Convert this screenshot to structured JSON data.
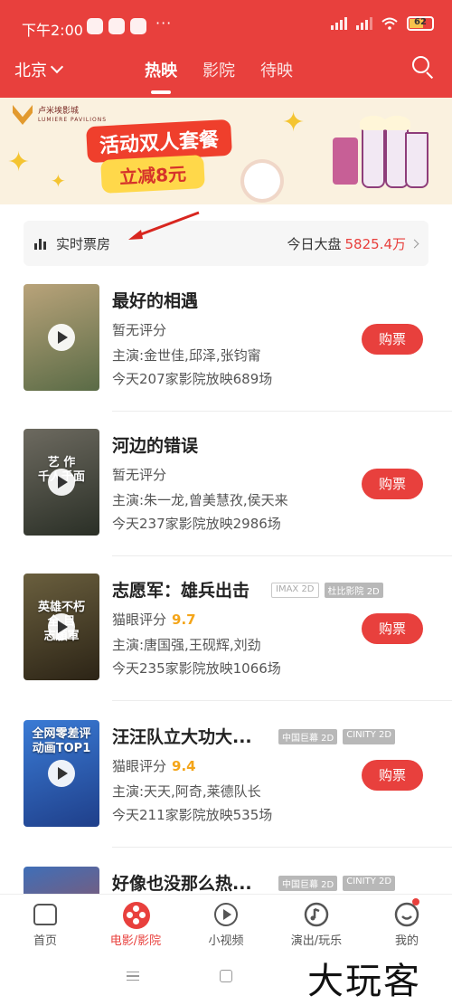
{
  "status_bar": {
    "time": "下午2:00",
    "dots": "···",
    "battery": "62",
    "battery_level": 0.62
  },
  "header": {
    "city": "北京",
    "tabs": [
      "热映",
      "影院",
      "待映"
    ],
    "active_tab": "热映"
  },
  "banner": {
    "brand": "卢米埃影城",
    "brand_en": "LUMIERE PAVILIONS",
    "headline": "活动双人套餐",
    "subline": "立减8元"
  },
  "box_office": {
    "label": "实时票房",
    "today_label": "今日大盘",
    "today_value": "5825.4万"
  },
  "movies": [
    {
      "title": "最好的相遇",
      "rating": "暂无评分",
      "score": "",
      "cast": "主演:金世佳,邱泽,张钧甯",
      "shows": "今天207家影院放映689场",
      "buy": "购票",
      "tags": [],
      "poster_text": "",
      "poster_colors": [
        "#b9a37a",
        "#5a6b46"
      ]
    },
    {
      "title": "河边的错误",
      "rating": "暂无评分",
      "score": "",
      "cast": "主演:朱一龙,曾美慧孜,侯天来",
      "shows": "今天237家影院放映2986场",
      "buy": "购票",
      "tags": [],
      "poster_text": "艺 作\n千人千面",
      "poster_colors": [
        "#6d6a60",
        "#2a2f26"
      ]
    },
    {
      "title": "志愿军：雄兵出击",
      "rating": "猫眼评分",
      "score": "9.7",
      "cast": "主演:唐国强,王砚辉,刘劲",
      "shows": "今天235家影院放映1066场",
      "buy": "购票",
      "tags": [
        "IMAX 2D",
        "杜比影院 2D"
      ],
      "poster_text": "英雄不朽\n全 目\n志願軍",
      "poster_colors": [
        "#6a5f3e",
        "#2c2416"
      ]
    },
    {
      "title": "汪汪队立大功大...",
      "rating": "猫眼评分",
      "score": "9.4",
      "cast": "主演:天天,阿奇,莱德队长",
      "shows": "今天211家影院放映535场",
      "buy": "购票",
      "tags": [
        "中国巨幕 2D",
        "CINITY 2D"
      ],
      "poster_text": "全网零差评\n动画TOP1",
      "poster_colors": [
        "#3a7bd5",
        "#1f3f8a"
      ]
    },
    {
      "title": "好像也没那么热...",
      "tags": [
        "中国巨幕 2D",
        "CINITY 2D"
      ],
      "poster_colors": [
        "#3f6fb8",
        "#b8473b"
      ]
    }
  ],
  "bottom_nav": [
    {
      "label": "首页",
      "icon": "home-icon"
    },
    {
      "label": "电影/影院",
      "icon": "film-reel-icon",
      "active": true
    },
    {
      "label": "小视频",
      "icon": "play-circle-icon"
    },
    {
      "label": "演出/玩乐",
      "icon": "music-note-icon"
    },
    {
      "label": "我的",
      "icon": "profile-icon"
    }
  ],
  "watermark": "大玩客",
  "colors": {
    "brand_red": "#e8403d",
    "score_gold": "#f4a519"
  }
}
